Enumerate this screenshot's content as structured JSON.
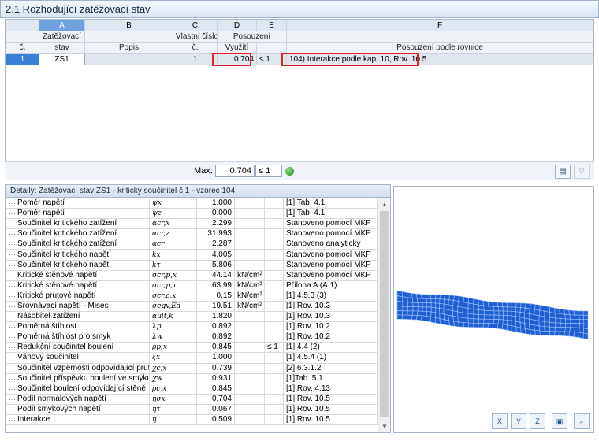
{
  "window": {
    "title": "2.1 Rozhodující zatěžovací stav"
  },
  "table": {
    "col_letters": [
      "A",
      "B",
      "C",
      "D",
      "E",
      "F"
    ],
    "header_row1": {
      "num": "",
      "a": "Zatěžovací",
      "b": "",
      "c": "Vlastní číslo",
      "de": "Posouzení",
      "f": ""
    },
    "header_row2": {
      "num": "č.",
      "a": "stav",
      "b": "Popis",
      "c": "č.",
      "d": "Využití",
      "e": "",
      "f": "Posouzení podle rovnice"
    },
    "rows": [
      {
        "num": "1",
        "loadcase": "ZS1",
        "desc": "",
        "eigen": "1",
        "ratio": "0.704",
        "le": "≤ 1",
        "equation": "104) Interakce podle kap. 10, Rov. 10.5"
      }
    ]
  },
  "max": {
    "label": "Max:",
    "value": "0.704",
    "le": "≤ 1",
    "status_color": "#1e8f1e"
  },
  "details": {
    "title": "Detaily:  Zatěžovací stav ZS1 - kritický součinitel č.1 - vzorec 104",
    "rows": [
      {
        "name": "Poměr napětí",
        "sym": "ψx",
        "value": "1.000",
        "unit": "",
        "le": "",
        "ref": "[1] Tab. 4.1"
      },
      {
        "name": "Poměr napětí",
        "sym": "ψz",
        "value": "0.000",
        "unit": "",
        "le": "",
        "ref": "[1] Tab. 4.1"
      },
      {
        "name": "Součinitel kritického zatížení",
        "sym": "αcr,x",
        "value": "2.299",
        "unit": "",
        "le": "",
        "ref": "Stanoveno pomocí MKP"
      },
      {
        "name": "Součinitel kritického zatížení",
        "sym": "αcr,z",
        "value": "31.993",
        "unit": "",
        "le": "",
        "ref": "Stanoveno pomocí MKP"
      },
      {
        "name": "Součinitel kritického zatížení",
        "sym": "αcr",
        "value": "2.287",
        "unit": "",
        "le": "",
        "ref": "Stanoveno analyticky"
      },
      {
        "name": "Součinitel kritického napětí",
        "sym": "kx",
        "value": "4.005",
        "unit": "",
        "le": "",
        "ref": "Stanoveno pomocí MKP"
      },
      {
        "name": "Součinitel kritického napětí",
        "sym": "kτ",
        "value": "5.806",
        "unit": "",
        "le": "",
        "ref": "Stanoveno pomocí MKP"
      },
      {
        "name": "Kritické stěnové napětí",
        "sym": "σcr,p,x",
        "value": "44.14",
        "unit": "kN/cm²",
        "le": "",
        "ref": "Stanoveno pomocí MKP"
      },
      {
        "name": "Kritické stěnové napětí",
        "sym": "σcr,p,τ",
        "value": "63.99",
        "unit": "kN/cm²",
        "le": "",
        "ref": "Příloha A (A.1)"
      },
      {
        "name": "Kritické prutové napětí",
        "sym": "σcr,c,x",
        "value": "0.15",
        "unit": "kN/cm²",
        "le": "",
        "ref": "[1] 4.5.3 (3)"
      },
      {
        "name": "Srovnávací napětí - Mises",
        "sym": "σeqv,Ed",
        "value": "19.51",
        "unit": "kN/cm²",
        "le": "",
        "ref": "[1] Rov. 10.3"
      },
      {
        "name": "Násobitel zatížení",
        "sym": "αult,k",
        "value": "1.820",
        "unit": "",
        "le": "",
        "ref": "[1] Rov. 10.3"
      },
      {
        "name": "Poměrná štíhlost",
        "sym": "λp",
        "value": "0.892",
        "unit": "",
        "le": "",
        "ref": "[1] Rov. 10.2"
      },
      {
        "name": "Poměrná štíhlost pro smyk",
        "sym": "λw",
        "value": "0.892",
        "unit": "",
        "le": "",
        "ref": "[1] Rov. 10.2"
      },
      {
        "name": "Redukční součinitel boulení",
        "sym": "ρp,x",
        "value": "0.845",
        "unit": "",
        "le": "≤ 1",
        "ref": "[1] 4.4 (2)"
      },
      {
        "name": "Váhový součinitel",
        "sym": "ξx",
        "value": "1.000",
        "unit": "",
        "le": "",
        "ref": "[1] 4.5.4 (1)"
      },
      {
        "name": "Součinitel vzpěrnosti odpovídající prutu",
        "sym": "χc,x",
        "value": "0.739",
        "unit": "",
        "le": "",
        "ref": "[2] 6.3.1.2"
      },
      {
        "name": "Součinitel příspěvku boulení ve smyku",
        "sym": "χw",
        "value": "0.931",
        "unit": "",
        "le": "",
        "ref": "[1]Tab. 5.1"
      },
      {
        "name": "Součinitel boulení odpovídající stěně",
        "sym": "ρc,x",
        "value": "0.845",
        "unit": "",
        "le": "",
        "ref": "[1] Rov. 4.13"
      },
      {
        "name": "Podíl normálových napětí",
        "sym": "ησx",
        "value": "0.704",
        "unit": "",
        "le": "",
        "ref": "[1] Rov. 10.5"
      },
      {
        "name": "Podíl smykových napětí",
        "sym": "ητ",
        "value": "0.067",
        "unit": "",
        "le": "",
        "ref": "[1] Rov. 10.5"
      },
      {
        "name": "Interakce",
        "sym": "η",
        "value": "0.509",
        "unit": "",
        "le": "",
        "ref": "[1] Rov. 10.5"
      }
    ]
  },
  "toolbar_icons": [
    "chart-icon",
    "filter-icon"
  ],
  "view_buttons": [
    "view-x-icon",
    "view-y-icon",
    "view-z-icon",
    "iso-view-icon",
    "zoom-icon"
  ],
  "colors": {
    "mesh_fill": "#1f5fd4",
    "mesh_line": "#9ec1ff",
    "highlight": "#e0202a",
    "selected_row": "#3b7fd4"
  }
}
